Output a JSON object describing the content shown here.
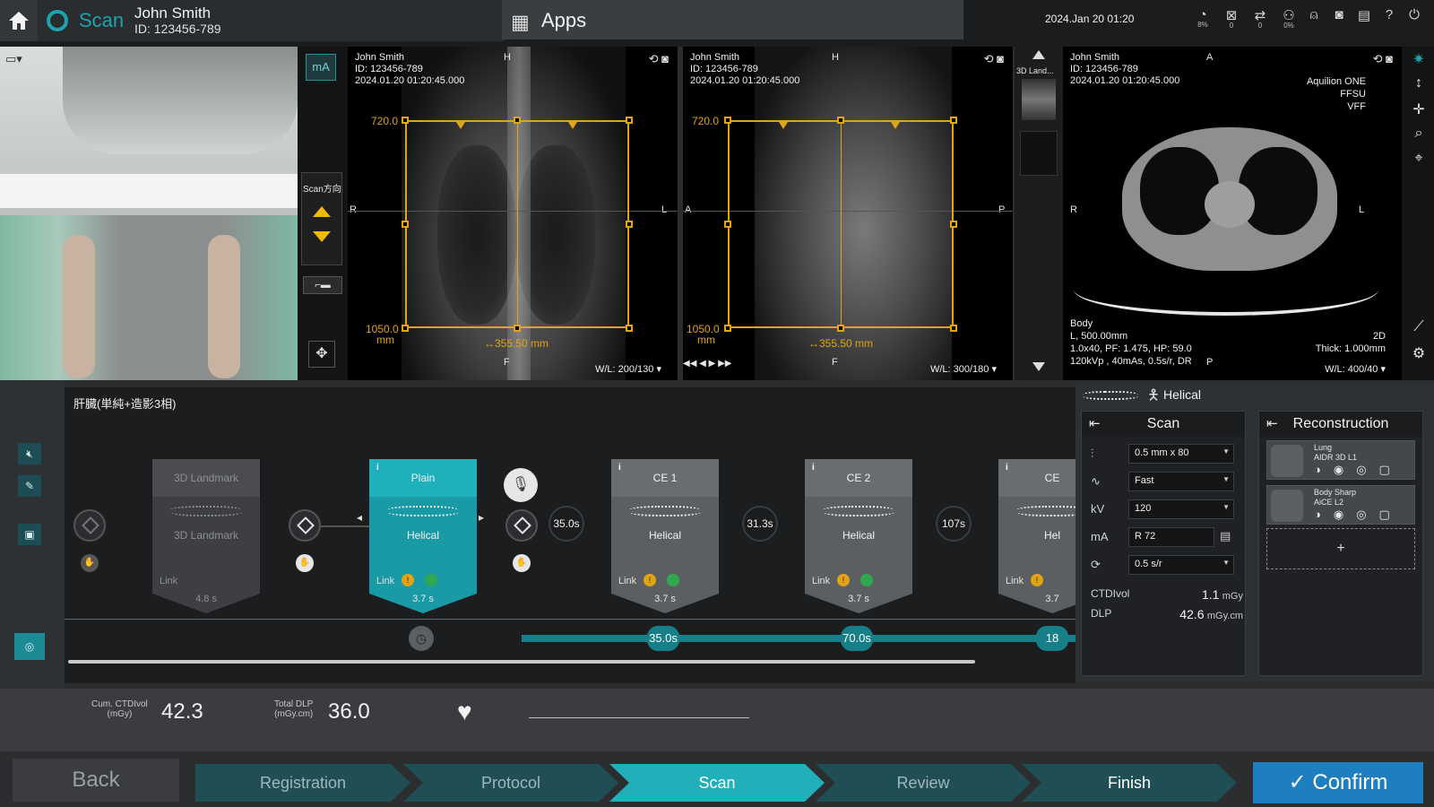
{
  "header": {
    "app_label": "Scan",
    "patient_name": "John Smith",
    "patient_id": "ID: 123456-789",
    "apps_label": "Apps",
    "datetime": "2024.Jan 20 01:20",
    "status_icons": [
      {
        "icon": "disk-icon",
        "value": "8%"
      },
      {
        "icon": "transfer-icon",
        "value": "0"
      },
      {
        "icon": "queue-icon",
        "value": "0"
      },
      {
        "icon": "network-icon",
        "value": "0%"
      },
      {
        "icon": "gantry-icon",
        "value": ""
      },
      {
        "icon": "camera-icon",
        "value": ""
      },
      {
        "icon": "document-icon",
        "value": ""
      },
      {
        "icon": "help-icon",
        "value": ""
      },
      {
        "icon": "power-icon",
        "value": ""
      }
    ]
  },
  "tools": {
    "ma_label": "mA",
    "scan_direction_label": "Scan方向"
  },
  "viewer_ap": {
    "name": "John Smith",
    "id": "ID: 123456-789",
    "date": "2024.01.20 01:20:45.000",
    "orient_top": "H",
    "orient_left": "R",
    "orient_right": "L",
    "orient_bottom": "F",
    "top_value": "720.0",
    "bottom_value": "1050.0",
    "unit": "mm",
    "width_label": "↔355.50 mm",
    "wl": "W/L: 200/130 ▾"
  },
  "viewer_lat": {
    "name": "John Smith",
    "id": "ID: 123456-789",
    "date": "2024.01.20 01:20:45.000",
    "orient_top": "H",
    "orient_left": "A",
    "orient_right": "P",
    "orient_bottom": "F",
    "top_value": "720.0",
    "bottom_value": "1050.0",
    "unit": "mm",
    "width_label": "↔355.50 mm",
    "wl": "W/L: 300/180 ▾",
    "nav": "◀◀  ◀  ▶  ▶▶"
  },
  "thumb": {
    "label": "3D Land..."
  },
  "viewer_axial": {
    "name": "John Smith",
    "id": "ID: 123456-789",
    "date": "2024.01.20 01:20:45.000",
    "orient_top": "A",
    "orient_left": "R",
    "orient_right": "L",
    "orient_bottom": "P",
    "scanner": "Aquilion ONE",
    "ffsu": "FFSU",
    "vff": "VFF",
    "region": "Body",
    "l_value": "L, 500.00mm",
    "params1": "1.0x40, PF: 1.475, HP: 59.0",
    "params2": "120kVp , 40mAs, 0.5s/r, DR",
    "dim": "2D",
    "thick": "Thick: 1.000mm",
    "wl": "W/L: 400/40 ▾"
  },
  "protocol": {
    "title": "肝臓(単純+造影3相)",
    "steps": [
      {
        "title": "3D Landmark",
        "mode": "3D Landmark",
        "link": "Link",
        "time": "4.8 s"
      },
      {
        "title": "Plain",
        "mode": "Helical",
        "link": "Link",
        "time": "3.7 s"
      },
      {
        "title": "CE 1",
        "mode": "Helical",
        "link": "Link",
        "time": "3.7 s"
      },
      {
        "title": "CE 2",
        "mode": "Helical",
        "link": "Link",
        "time": "3.7 s"
      },
      {
        "title": "CE",
        "mode": "Hel",
        "link": "Link",
        "time": "3.7"
      }
    ],
    "delays": [
      "35.0s",
      "31.3s",
      "107s"
    ],
    "track_nodes": [
      "35.0s",
      "70.0s",
      "18"
    ]
  },
  "scan_panel": {
    "mode": "Helical",
    "title": "Scan",
    "rows": [
      {
        "label": "",
        "value": "0.5 mm x 80"
      },
      {
        "label": "",
        "value": "Fast"
      },
      {
        "label": "kV",
        "value": "120"
      },
      {
        "label": "mA",
        "value": "R 72"
      },
      {
        "label": "",
        "value": "0.5 s/r"
      }
    ],
    "ctdi_label": "CTDIvol",
    "ctdi_value": "1.1",
    "ctdi_unit": "mGy",
    "dlp_label": "DLP",
    "dlp_value": "42.6",
    "dlp_unit": "mGy.cm"
  },
  "recon_panel": {
    "title": "Reconstruction",
    "items": [
      {
        "name": "Lung",
        "sub": "AIDR 3D L1"
      },
      {
        "name": "Body Sharp",
        "sub": "AiCE L2"
      }
    ],
    "add": "+"
  },
  "dose": {
    "cum_label": "Cum. CTDIvol",
    "cum_unit": "(mGy)",
    "cum_value": "42.3",
    "dlp_label": "Total DLP",
    "dlp_unit": "(mGy.cm)",
    "dlp_value": "36.0"
  },
  "nav": {
    "back": "Back",
    "steps": [
      "Registration",
      "Protocol",
      "Scan",
      "Review",
      "Finish"
    ],
    "active": "Scan",
    "confirm": "✓ Confirm"
  },
  "colors": {
    "accent": "#1da3ad",
    "roi": "#e1a414",
    "confirm": "#1d7fc0"
  }
}
